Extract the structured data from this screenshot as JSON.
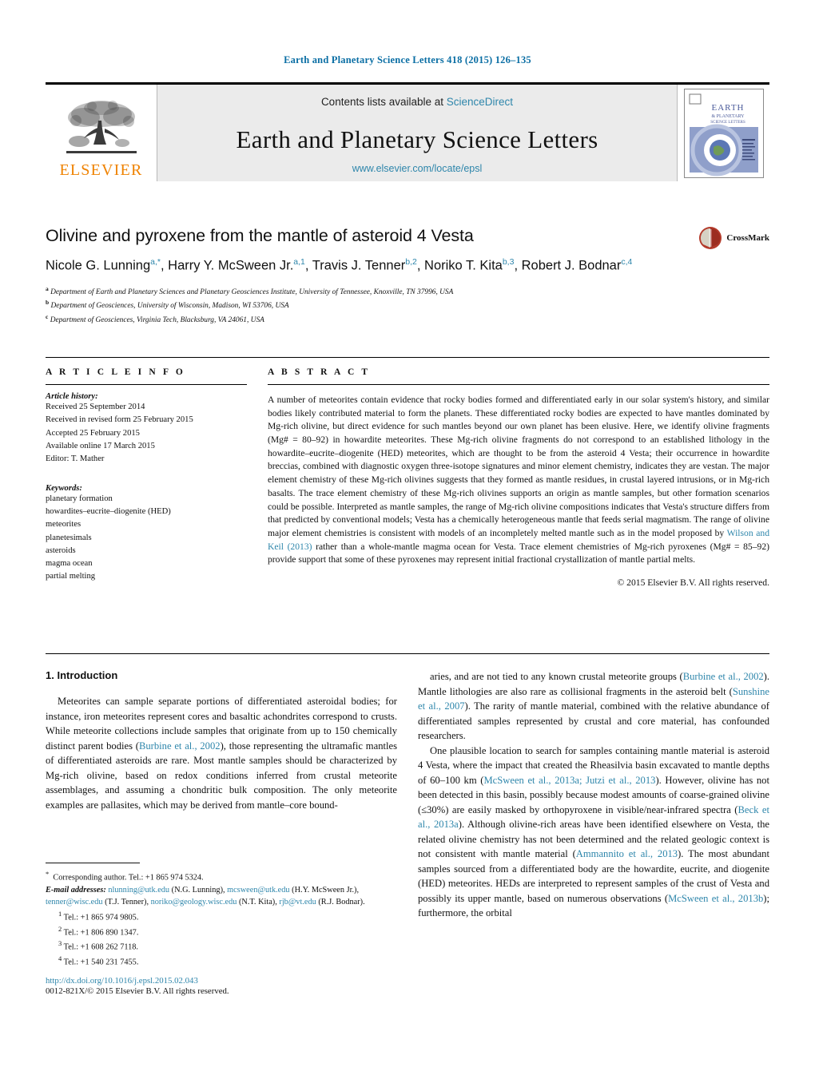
{
  "running_head": "Earth and Planetary Science Letters 418 (2015) 126–135",
  "masthead": {
    "contents_prefix": "Contents lists available at ",
    "sciencedirect": "ScienceDirect",
    "journal_title": "Earth and Planetary Science Letters",
    "journal_url": "www.elsevier.com/locate/epsl",
    "publisher": "ELSEVIER",
    "cover_title_line1": "EARTH",
    "cover_title_line2": "& PLANETARY",
    "cover_title_line3": "SCIENCE LETTERS"
  },
  "article": {
    "title": "Olivine and pyroxene from the mantle of asteroid 4 Vesta",
    "crossmark_label": "CrossMark",
    "authors_html": "Nicole G. Lunning<sup>a,*</sup>, Harry Y. McSween Jr.<sup>a,1</sup>, Travis J. Tenner<sup>b,2</sup>, Noriko T. Kita<sup>b,3</sup>, Robert J. Bodnar<sup>c,4</sup>",
    "affiliations": [
      {
        "mark": "a",
        "text": "Department of Earth and Planetary Sciences and Planetary Geosciences Institute, University of Tennessee, Knoxville, TN 37996, USA"
      },
      {
        "mark": "b",
        "text": "Department of Geosciences, University of Wisconsin, Madison, WI 53706, USA"
      },
      {
        "mark": "c",
        "text": "Department of Geosciences, Virginia Tech, Blacksburg, VA 24061, USA"
      }
    ]
  },
  "article_info": {
    "heading": "A R T I C L E    I N F O",
    "history_label": "Article history:",
    "history": [
      "Received 25 September 2014",
      "Received in revised form 25 February 2015",
      "Accepted 25 February 2015",
      "Available online 17 March 2015",
      "Editor: T. Mather"
    ],
    "keywords_label": "Keywords:",
    "keywords": [
      "planetary formation",
      "howardites–eucrite–diogenite (HED)",
      "meteorites",
      "planetesimals",
      "asteroids",
      "magma ocean",
      "partial melting"
    ]
  },
  "abstract": {
    "heading": "A B S T R A C T",
    "body_html": "A number of meteorites contain evidence that rocky bodies formed and differentiated early in our solar system's history, and similar bodies likely contributed material to form the planets. These differentiated rocky bodies are expected to have mantles dominated by Mg-rich olivine, but direct evidence for such mantles beyond our own planet has been elusive. Here, we identify olivine fragments (Mg# = 80–92) in howardite meteorites. These Mg-rich olivine fragments do not correspond to an established lithology in the howardite–eucrite–diogenite (HED) meteorites, which are thought to be from the asteroid 4 Vesta; their occurrence in howardite breccias, combined with diagnostic oxygen three-isotope signatures and minor element chemistry, indicates they are vestan. The major element chemistry of these Mg-rich olivines suggests that they formed as mantle residues, in crustal layered intrusions, or in Mg-rich basalts. The trace element chemistry of these Mg-rich olivines supports an origin as mantle samples, but other formation scenarios could be possible. Interpreted as mantle samples, the range of Mg-rich olivine compositions indicates that Vesta's structure differs from that predicted by conventional models; Vesta has a chemically heterogeneous mantle that feeds serial magmatism. The range of olivine major element chemistries is consistent with models of an incompletely melted mantle such as in the model proposed by <span class=\"lnk\">Wilson and Keil (2013)</span> rather than a whole-mantle magma ocean for Vesta. Trace element chemistries of Mg-rich pyroxenes (Mg# = 85–92) provide support that some of these pyroxenes may represent initial fractional crystallization of mantle partial melts.",
    "copyright": "© 2015 Elsevier B.V. All rights reserved."
  },
  "body": {
    "section_heading": "1. Introduction",
    "left_paragraph_html": "Meteorites can sample separate portions of differentiated asteroidal bodies; for instance, iron meteorites represent cores and basaltic achondrites correspond to crusts. While meteorite collections include samples that originate from up to 150 chemically distinct parent bodies (<span class=\"lnk\">Burbine et al., 2002</span>), those representing the ultramafic mantles of differentiated asteroids are rare. Most mantle samples should be characterized by Mg-rich olivine, based on redox conditions inferred from crustal meteorite assemblages, and assuming a chondritic bulk composition. The only meteorite examples are pallasites, which may be derived from mantle–core bound-",
    "right_paragraph_1_html": "aries, and are not tied to any known crustal meteorite groups (<span class=\"lnk\">Burbine et al., 2002</span>). Mantle lithologies are also rare as collisional fragments in the asteroid belt (<span class=\"lnk\">Sunshine et al., 2007</span>). The rarity of mantle material, combined with the relative abundance of differentiated samples represented by crustal and core material, has confounded researchers.",
    "right_paragraph_2_html": "One plausible location to search for samples containing mantle material is asteroid 4 Vesta, where the impact that created the Rheasilvia basin excavated to mantle depths of 60–100 km (<span class=\"lnk\">McSween et al., 2013a; Jutzi et al., 2013</span>). However, olivine has not been detected in this basin, possibly because modest amounts of coarse-grained olivine (≤30%) are easily masked by orthopyroxene in visible/near-infrared spectra (<span class=\"lnk\">Beck et al., 2013a</span>). Although olivine-rich areas have been identified elsewhere on Vesta, the related olivine chemistry has not been determined and the related geologic context is not consistent with mantle material (<span class=\"lnk\">Ammannito et al., 2013</span>). The most abundant samples sourced from a differentiated body are the howardite, eucrite, and diogenite (HED) meteorites. HEDs are interpreted to represent samples of the crust of Vesta and possibly its upper mantle, based on numerous observations (<span class=\"lnk\">McSween et al., 2013b</span>); furthermore, the orbital"
  },
  "footnotes": {
    "corresponding_html": "<span class=\"mark fn-star\">*</span>&nbsp; Corresponding author. Tel.: +1 865 974 5324.",
    "emails_html": "<span class=\"em\">E-mail addresses:</span> <span class=\"lnk\">nlunning@utk.edu</span> (N.G. Lunning), <span class=\"lnk\">mcsween@utk.edu</span> (H.Y. McSween Jr.), <span class=\"lnk\">tenner@wisc.edu</span> (T.J. Tenner), <span class=\"lnk\">noriko@geology.wisc.edu</span> (N.T. Kita), <span class=\"lnk\">rjb@vt.edu</span> (R.J. Bodnar).",
    "tels": [
      {
        "mark": "1",
        "text": "Tel.: +1 865 974 9805."
      },
      {
        "mark": "2",
        "text": "Tel.: +1 806 890 1347."
      },
      {
        "mark": "3",
        "text": "Tel.: +1 608 262 7118."
      },
      {
        "mark": "4",
        "text": "Tel.: +1 540 231 7455."
      }
    ]
  },
  "footer": {
    "doi": "http://dx.doi.org/10.1016/j.epsl.2015.02.043",
    "issn_line": "0012-821X/© 2015 Elsevier B.V. All rights reserved."
  },
  "colors": {
    "link_blue": "#2e86ab",
    "elsevier_orange": "#ef8200",
    "masthead_gray": "#ebebeb"
  }
}
